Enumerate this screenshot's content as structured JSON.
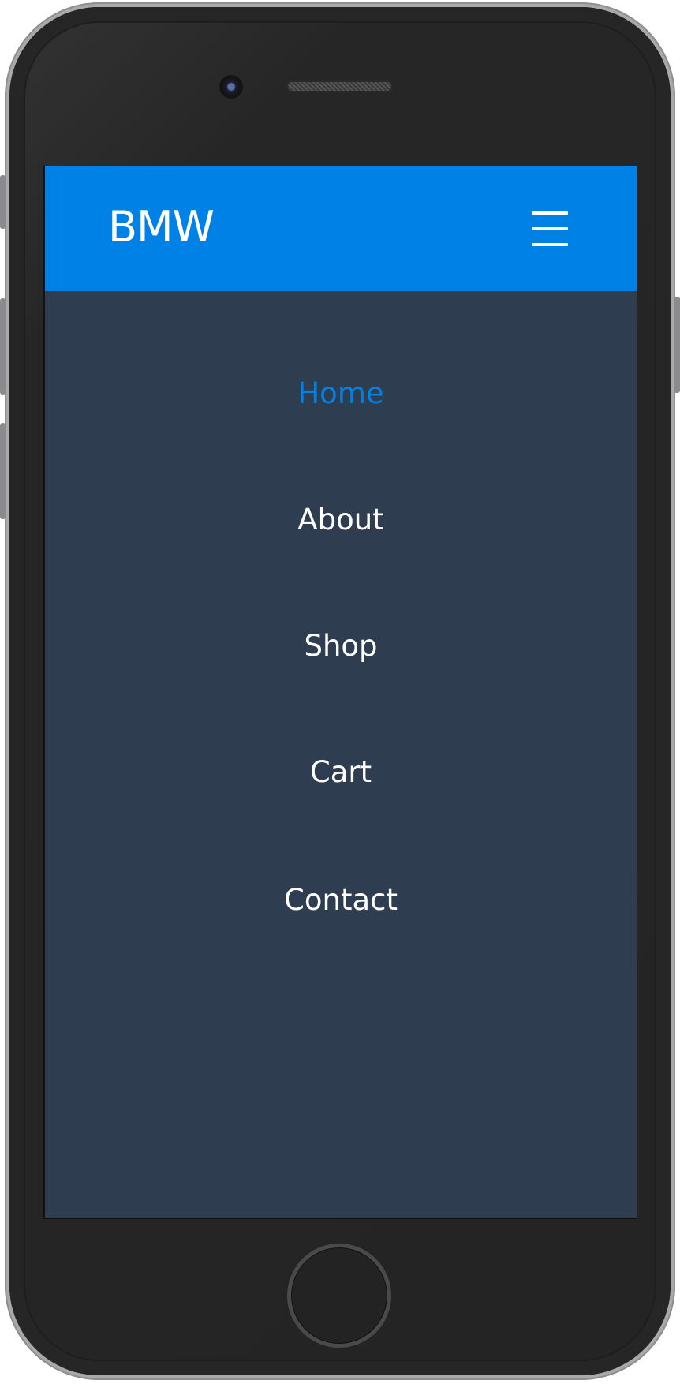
{
  "app": {
    "brand": "BMW",
    "accent_color": "#0081e5",
    "menu_background": "#2e3e50"
  },
  "header": {
    "menu_icon": "hamburger-icon"
  },
  "menu": {
    "items": [
      {
        "label": "Home",
        "active": true
      },
      {
        "label": "About",
        "active": false
      },
      {
        "label": "Shop",
        "active": false
      },
      {
        "label": "Cart",
        "active": false
      },
      {
        "label": "Contact",
        "active": false
      }
    ]
  },
  "device": {
    "frame": "smartphone",
    "hardware_icons": [
      "front-camera-icon",
      "speaker-grille-icon",
      "home-button-icon"
    ]
  }
}
